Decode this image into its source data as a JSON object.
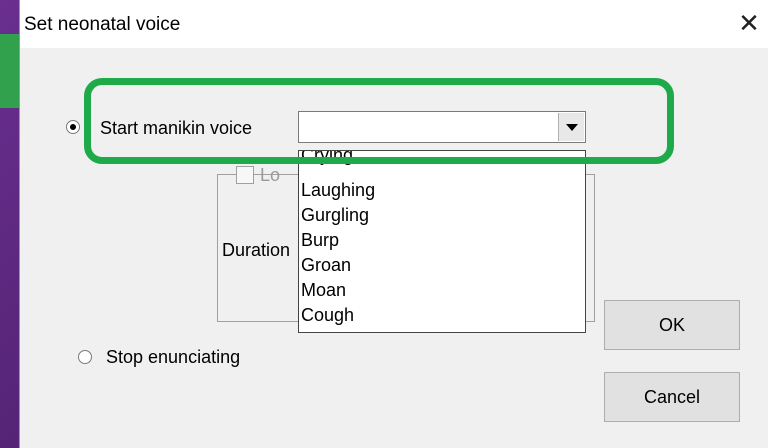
{
  "dialog": {
    "title": "Set neonatal voice",
    "close_symbol": "✕",
    "start_option_label": "Start manikin voice",
    "stop_option_label": "Stop enunciating",
    "combo_value": "",
    "checkbox_label_partial": "Lo",
    "duration_label_partial": "Duration",
    "dropdown_items": [
      "Crying",
      "Laughing",
      "Gurgling",
      "Burp",
      "Groan",
      "Moan",
      "Cough"
    ],
    "ok_label": "OK",
    "cancel_label": "Cancel"
  },
  "colors": {
    "background_purple": "#4b1f6b",
    "highlight_green": "#1faa4a",
    "dialog_gray": "#f0f0f0"
  }
}
